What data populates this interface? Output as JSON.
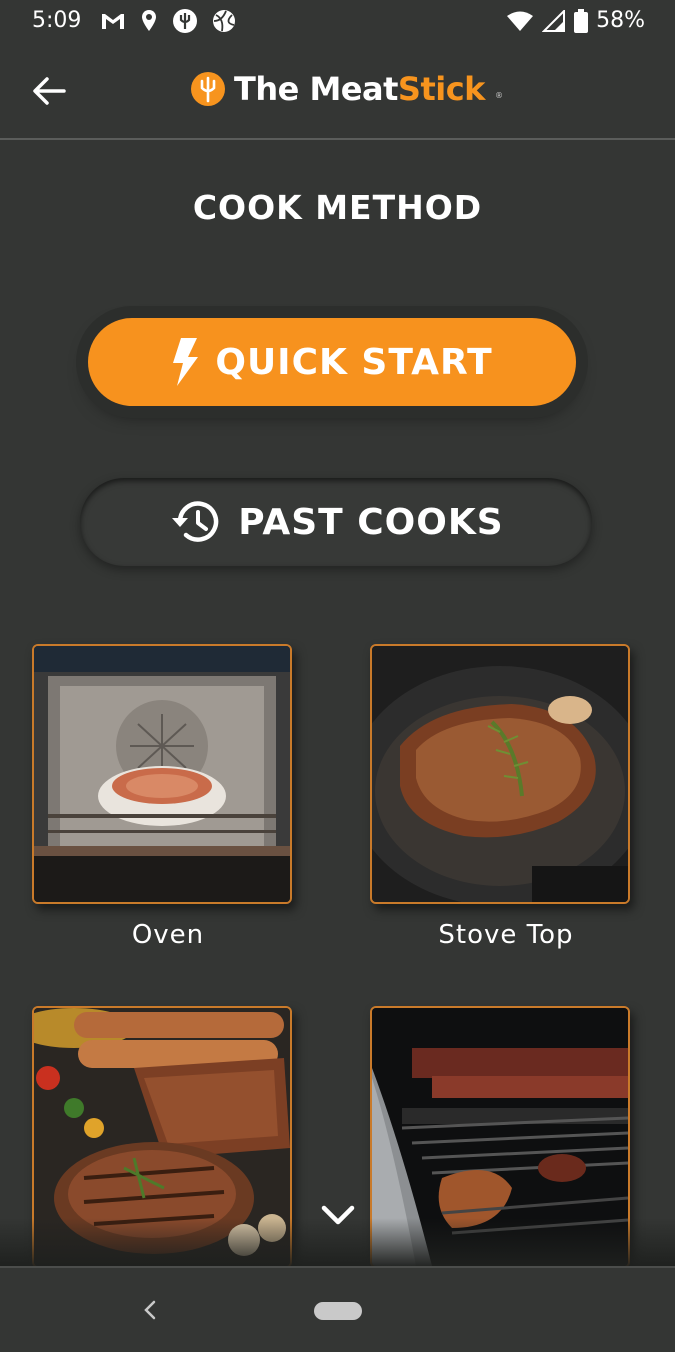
{
  "status_bar": {
    "time": "5:09",
    "battery_text": "58%",
    "left_icons": [
      "gmail-icon",
      "location-pin-icon",
      "meatstick-notification-icon",
      "sports-ball-icon"
    ],
    "right_icons": [
      "wifi-icon",
      "signal-icon",
      "battery-icon"
    ]
  },
  "header": {
    "logo_word_1": "The Meat",
    "logo_word_2": "Stick",
    "logo_reg": "®",
    "brand_color": "#f7941e"
  },
  "page": {
    "title": "COOK METHOD"
  },
  "buttons": {
    "quick_start": "QUICK START",
    "past_cooks": "PAST COOKS"
  },
  "methods": [
    {
      "label": "Oven"
    },
    {
      "label": "Stove Top"
    },
    {
      "label": ""
    },
    {
      "label": ""
    }
  ],
  "colors": {
    "background": "#343634",
    "accent": "#f7921e",
    "tile_border": "#c97a2a"
  }
}
